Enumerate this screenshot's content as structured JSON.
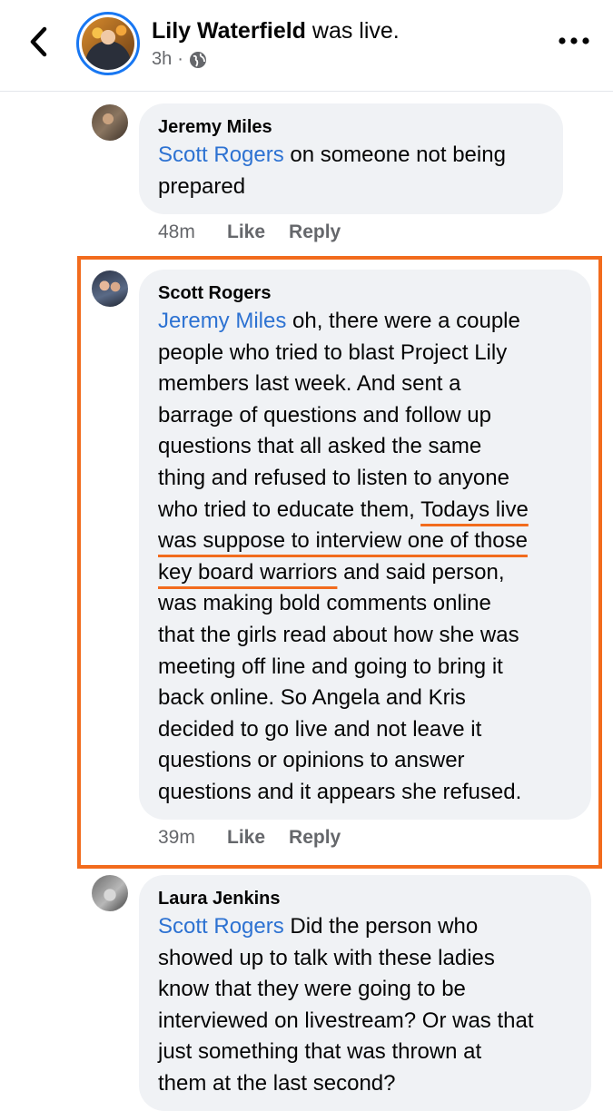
{
  "header": {
    "host_name": "Lily Waterfield",
    "status_text": " was live.",
    "time": "3h",
    "separator": "·"
  },
  "comments": [
    {
      "author": "Jeremy Miles",
      "mention": "Scott Rogers",
      "text": " on someone not being\nprepared",
      "time": "48m",
      "like_label": "Like",
      "reply_label": "Reply"
    },
    {
      "author": "Scott Rogers",
      "mention": "Jeremy Miles",
      "text_before": " oh, there were a couple\npeople who tried to blast Project Lily\nmembers last week. And sent a\nbarrage of questions and follow up\nquestions that all asked the same\nthing and refused to listen to anyone\nwho tried to educate them, ",
      "underlined_1": "Todays live",
      "line_break": "\n",
      "underlined_2": "was suppose to interview one of those",
      "line_break_2": "\n",
      "underlined_3": "key board warriors",
      "text_after": " and said person,\nwas making bold comments online\nthat the girls read about how she was\nmeeting off line and going to bring it\nback online. So Angela and Kris\ndecided to go live and not leave it\nquestions or opinions to answer\nquestions and it appears she refused.",
      "time": "39m",
      "like_label": "Like",
      "reply_label": "Reply"
    },
    {
      "author": "Laura Jenkins",
      "mention": "Scott Rogers",
      "text": " Did the person who\nshowed up to talk with these ladies\nknow that they were going to be\ninterviewed on livestream? Or was that\njust something that was thrown at\nthem at the last second?"
    }
  ],
  "icons": {
    "back": "chevron-left-icon",
    "privacy": "globe-icon",
    "more": "more-horizontal-icon"
  },
  "colors": {
    "highlight": "#f26b1d",
    "mention": "#2d72d2",
    "live_ring": "#1877f2"
  }
}
